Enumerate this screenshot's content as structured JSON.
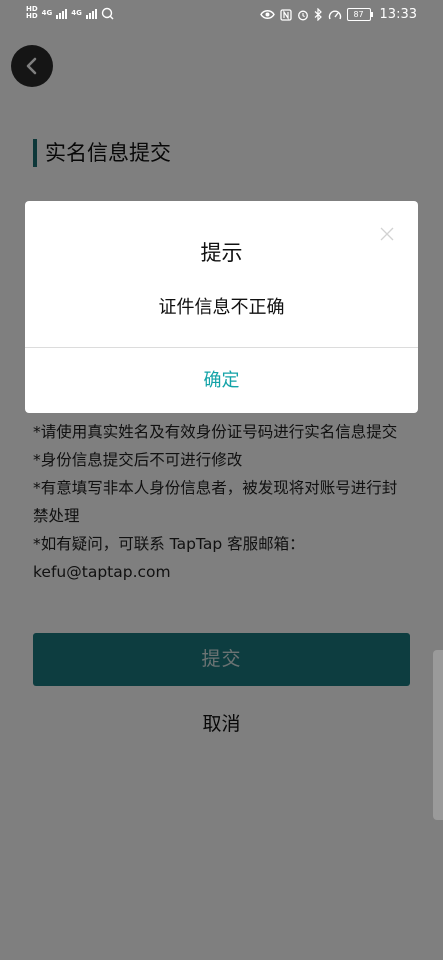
{
  "status_bar": {
    "net_hd1": "HD",
    "net_hd2": "HD",
    "net_4g_1": "4G",
    "net_4g_2": "4G",
    "battery": "87",
    "time": "13:33"
  },
  "page": {
    "section_title": "实名信息提交",
    "notes": [
      "*请使用真实姓名及有效身份证号码进行实名信息提交",
      "*身份信息提交后不可进行修改",
      "*有意填写非本人身份信息者，被发现将对账号进行封禁处理",
      "*如有疑问，可联系 TapTap 客服邮箱：kefu@taptap.com"
    ],
    "submit_label": "提交",
    "cancel_label": "取消"
  },
  "dialog": {
    "title": "提示",
    "message": "证件信息不正确",
    "confirm_label": "确定"
  },
  "colors": {
    "accent": "#1b7a80",
    "dialog_confirm": "#13a3a8",
    "overlay": "rgba(0,0,0,0.5)"
  }
}
